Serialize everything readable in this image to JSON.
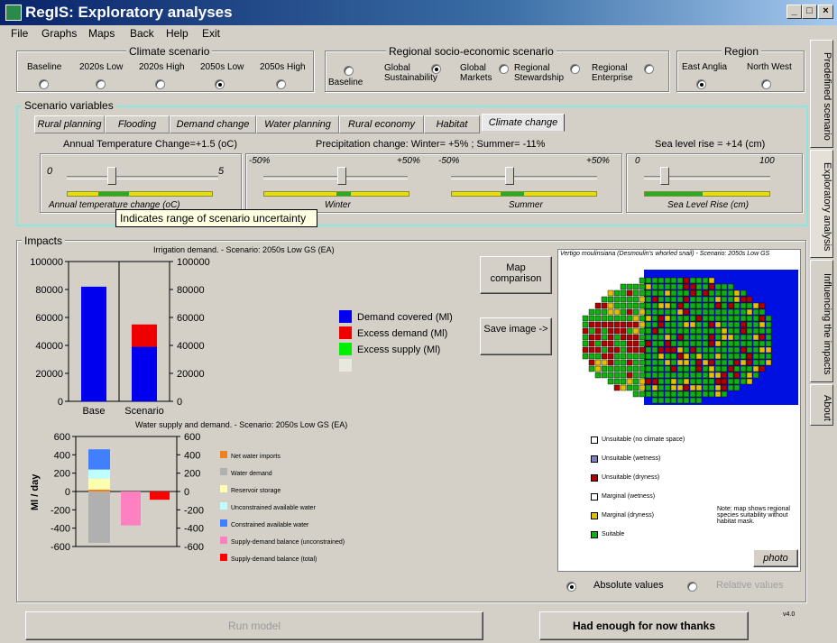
{
  "window": {
    "title": "RegIS: Exploratory analyses",
    "btn_min": "_",
    "btn_max": "□",
    "btn_close": "×"
  },
  "menu": [
    "File",
    "Graphs",
    "Maps",
    "Back",
    "Help",
    "Exit"
  ],
  "climate": {
    "label": "Climate scenario",
    "options": [
      "Baseline",
      "2020s Low",
      "2020s High",
      "2050s Low",
      "2050s High"
    ],
    "selected": "2050s Low"
  },
  "socio": {
    "label": "Regional socio-economic scenario",
    "options": [
      "Baseline",
      "Global Sustainability",
      "Global Markets",
      "Regional Stewardship",
      "Regional Enterprise"
    ],
    "selected": "Global Sustainability"
  },
  "region": {
    "label": "Region",
    "options": [
      "East Anglia",
      "North West"
    ],
    "selected": "East Anglia"
  },
  "side_tabs": [
    "Predefined scenario",
    "Exploratory analysis",
    "Influencing the impacts",
    "About"
  ],
  "scenario_vars": {
    "label": "Scenario variables",
    "tabs": [
      "Rural planning",
      "Flooding",
      "Demand change",
      "Water planning",
      "Rural economy",
      "Habitat",
      "Climate change"
    ],
    "active_tab": "Climate change",
    "temp": {
      "heading": "Annual Temperature Change=+1.5 (oC)",
      "min": "0",
      "max": "5",
      "caption": "Annual temperature change (oC)",
      "value": 1.5
    },
    "precip": {
      "heading": "Precipitation change: Winter= +5% ; Summer= -11%",
      "winter_min": "-50%",
      "winter_max": "+50%",
      "summer_min": "-50%",
      "summer_max": "+50%",
      "winter_caption": "Winter",
      "summer_caption": "Summer",
      "winter_value": 5,
      "summer_value": -11
    },
    "sea": {
      "heading": "Sea level rise = +14 (cm)",
      "min": "0",
      "max": "100",
      "caption": "Sea Level Rise (cm)",
      "value": 14
    },
    "tooltip": "Indicates range of scenario uncertainty"
  },
  "impacts": {
    "label": "Impacts"
  },
  "chart1": {
    "title": "Irrigation demand. - Scenario: 2050s Low GS (EA)",
    "yticks": [
      "100000",
      "80000",
      "60000",
      "40000",
      "20000",
      "0"
    ],
    "categories": [
      "Base",
      "Scenario"
    ],
    "legend": [
      "Demand covered (Ml)",
      "Excess demand (Ml)",
      "Excess supply (Ml)"
    ]
  },
  "chart2": {
    "title": "Water supply and demand. - Scenario: 2050s Low GS (EA)",
    "ylabel": "Ml / day",
    "yticks": [
      "600",
      "400",
      "200",
      "0",
      "-200",
      "-400",
      "-600"
    ],
    "legend": [
      "Net water imports",
      "Water demand",
      "Reservoir storage",
      "Unconstrained available water",
      "Constrained available water",
      "Supply-demand balance (unconstrained)",
      "Supply-demand balance (total)"
    ]
  },
  "chart_data": [
    {
      "type": "bar",
      "title": "Irrigation demand. - Scenario: 2050s Low GS (EA)",
      "categories": [
        "Base",
        "Scenario"
      ],
      "series": [
        {
          "name": "Demand covered (Ml)",
          "values": [
            82000,
            39000
          ]
        },
        {
          "name": "Excess demand (Ml)",
          "values": [
            0,
            16000
          ]
        },
        {
          "name": "Excess supply (Ml)",
          "values": [
            0,
            0
          ]
        }
      ],
      "ylim": [
        0,
        100000
      ]
    },
    {
      "type": "bar",
      "title": "Water supply and demand. - Scenario: 2050s Low GS (EA)",
      "ylabel": "Ml / day",
      "series": [
        {
          "name": "Net water imports",
          "values": [
            20
          ]
        },
        {
          "name": "Water demand",
          "values": [
            -560
          ]
        },
        {
          "name": "Reservoir storage",
          "values": [
            120
          ]
        },
        {
          "name": "Unconstrained available water",
          "values": [
            100
          ]
        },
        {
          "name": "Constrained available water",
          "values": [
            220
          ]
        },
        {
          "name": "Supply-demand balance (unconstrained)",
          "values": [
            -370
          ]
        },
        {
          "name": "Supply-demand balance (total)",
          "values": [
            -90
          ]
        }
      ],
      "ylim": [
        -600,
        600
      ]
    }
  ],
  "buttons": {
    "map_comparison": "Map comparison",
    "save_image": "Save image ->",
    "run_model": "Run model",
    "enough": "Had enough for now thanks",
    "photo": "photo"
  },
  "map": {
    "title": "Vertigo moulinsiana (Desmoulin's whorled snail) - Scenario: 2050s Low GS",
    "legend": [
      "Unsuitable (no climate space)",
      "Unsuitable (wetness)",
      "Unsuitable (dryness)",
      "Marginal (wetness)",
      "Marginal (dryness)",
      "Suitable"
    ],
    "note": "Note: map shows regional species suitability without habitat mask.",
    "legend_colors": [
      "#ffffff",
      "#8080c0",
      "#b00000",
      "#ffffff",
      "#e0c000",
      "#10b010"
    ]
  },
  "display": {
    "options": [
      "Absolute values",
      "Relative values"
    ],
    "selected": "Absolute values"
  },
  "version": "v4.0"
}
